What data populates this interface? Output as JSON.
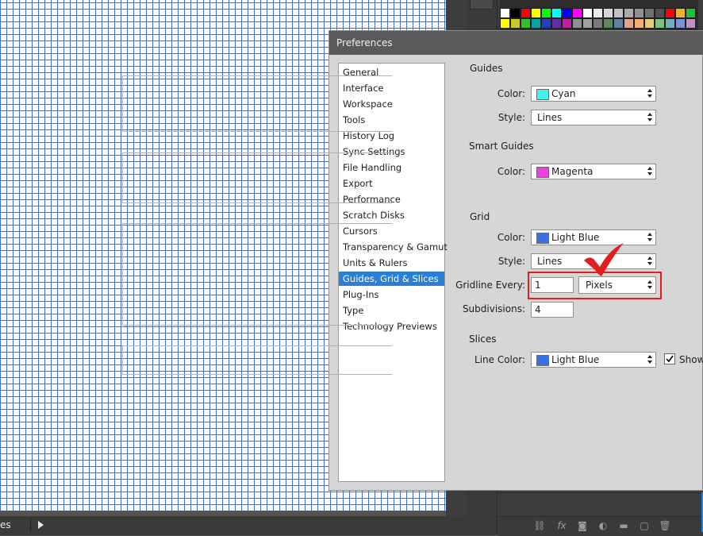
{
  "status": {
    "text": "es"
  },
  "dialog": {
    "title": "Preferences",
    "categories": [
      "General",
      "Interface",
      "Workspace",
      "Tools",
      "History Log",
      "Sync Settings",
      "File Handling",
      "Export",
      "Performance",
      "Scratch Disks",
      "Cursors",
      "Transparency & Gamut",
      "Units & Rulers",
      "Guides, Grid & Slices",
      "Plug-Ins",
      "Type",
      "Technology Previews"
    ],
    "selected_category": "Guides, Grid & Slices",
    "guides": {
      "title": "Guides",
      "color_label": "Color:",
      "color_value": "Cyan",
      "color_hex": "#44f0f0",
      "style_label": "Style:",
      "style_value": "Lines"
    },
    "smart_guides": {
      "title": "Smart Guides",
      "color_label": "Color:",
      "color_value": "Magenta",
      "color_hex": "#f040e0"
    },
    "grid": {
      "title": "Grid",
      "color_label": "Color:",
      "color_value": "Light Blue",
      "color_hex": "#3a70e6",
      "style_label": "Style:",
      "style_value": "Lines",
      "gridline_label": "Gridline Every:",
      "gridline_value": "1",
      "gridline_unit": "Pixels",
      "subdivisions_label": "Subdivisions:",
      "subdivisions_value": "4"
    },
    "slices": {
      "title": "Slices",
      "line_color_label": "Line Color:",
      "line_color_value": "Light Blue",
      "line_color_hex": "#3a70e6",
      "show_label": "Show",
      "show_checked": true
    }
  },
  "colors": {
    "grid_line": "#3a6fd6",
    "highlight": "#e02020",
    "selection": "#2a7fd4"
  }
}
